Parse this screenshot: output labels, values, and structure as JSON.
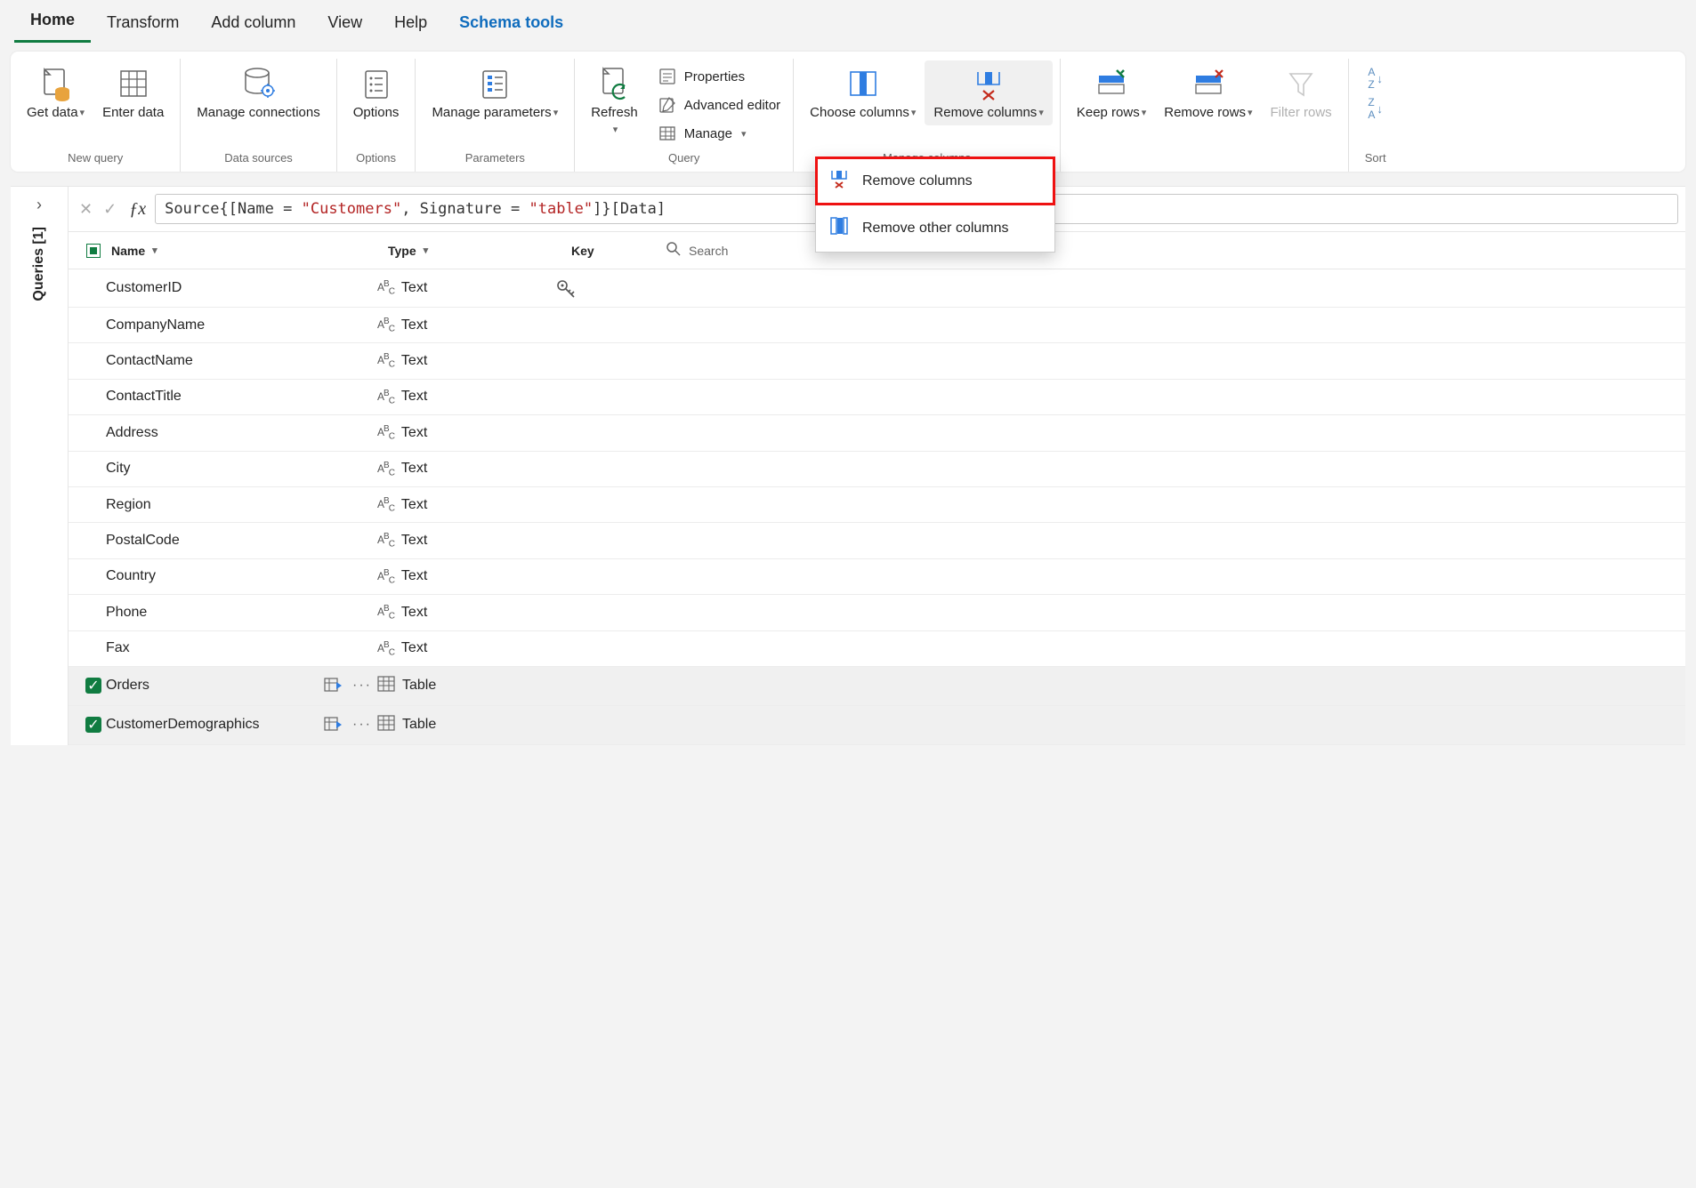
{
  "tabs": {
    "home": "Home",
    "transform": "Transform",
    "add_column": "Add column",
    "view": "View",
    "help": "Help",
    "schema_tools": "Schema tools"
  },
  "ribbon": {
    "new_query": {
      "get_data": "Get data",
      "enter_data": "Enter data",
      "label": "New query"
    },
    "data_sources": {
      "manage_conn": "Manage connections",
      "label": "Data sources"
    },
    "options": {
      "options": "Options",
      "label": "Options"
    },
    "parameters": {
      "manage_params": "Manage parameters",
      "label": "Parameters"
    },
    "query": {
      "refresh": "Refresh",
      "properties": "Properties",
      "advanced": "Advanced editor",
      "manage": "Manage",
      "label": "Query"
    },
    "manage_cols": {
      "choose": "Choose columns",
      "remove": "Remove columns",
      "label": "Manage columns"
    },
    "rows": {
      "keep": "Keep rows",
      "remove": "Remove rows",
      "filter": "Filter rows"
    },
    "sort": {
      "label": "Sort"
    }
  },
  "popup": {
    "remove_columns": "Remove columns",
    "remove_other": "Remove other columns"
  },
  "sidebar": {
    "queries": "Queries [1]"
  },
  "formula": {
    "parts": [
      "Source{[Name = ",
      "\"Customers\"",
      ", Signature = ",
      "\"table\"",
      "]}[Data]"
    ]
  },
  "schema": {
    "headers": {
      "name": "Name",
      "type": "Type",
      "key": "Key",
      "search": "Search"
    },
    "rows": [
      {
        "name": "CustomerID",
        "type": "Text",
        "typeicon": "abc",
        "key": true,
        "check": false,
        "nav": false
      },
      {
        "name": "CompanyName",
        "type": "Text",
        "typeicon": "abc",
        "key": false,
        "check": false,
        "nav": false
      },
      {
        "name": "ContactName",
        "type": "Text",
        "typeicon": "abc",
        "key": false,
        "check": false,
        "nav": false
      },
      {
        "name": "ContactTitle",
        "type": "Text",
        "typeicon": "abc",
        "key": false,
        "check": false,
        "nav": false
      },
      {
        "name": "Address",
        "type": "Text",
        "typeicon": "abc",
        "key": false,
        "check": false,
        "nav": false
      },
      {
        "name": "City",
        "type": "Text",
        "typeicon": "abc",
        "key": false,
        "check": false,
        "nav": false
      },
      {
        "name": "Region",
        "type": "Text",
        "typeicon": "abc",
        "key": false,
        "check": false,
        "nav": false
      },
      {
        "name": "PostalCode",
        "type": "Text",
        "typeicon": "abc",
        "key": false,
        "check": false,
        "nav": false
      },
      {
        "name": "Country",
        "type": "Text",
        "typeicon": "abc",
        "key": false,
        "check": false,
        "nav": false
      },
      {
        "name": "Phone",
        "type": "Text",
        "typeicon": "abc",
        "key": false,
        "check": false,
        "nav": false
      },
      {
        "name": "Fax",
        "type": "Text",
        "typeicon": "abc",
        "key": false,
        "check": false,
        "nav": false
      },
      {
        "name": "Orders",
        "type": "Table",
        "typeicon": "table",
        "key": false,
        "check": true,
        "nav": true
      },
      {
        "name": "CustomerDemographics",
        "type": "Table",
        "typeicon": "table",
        "key": false,
        "check": true,
        "nav": true
      }
    ]
  }
}
